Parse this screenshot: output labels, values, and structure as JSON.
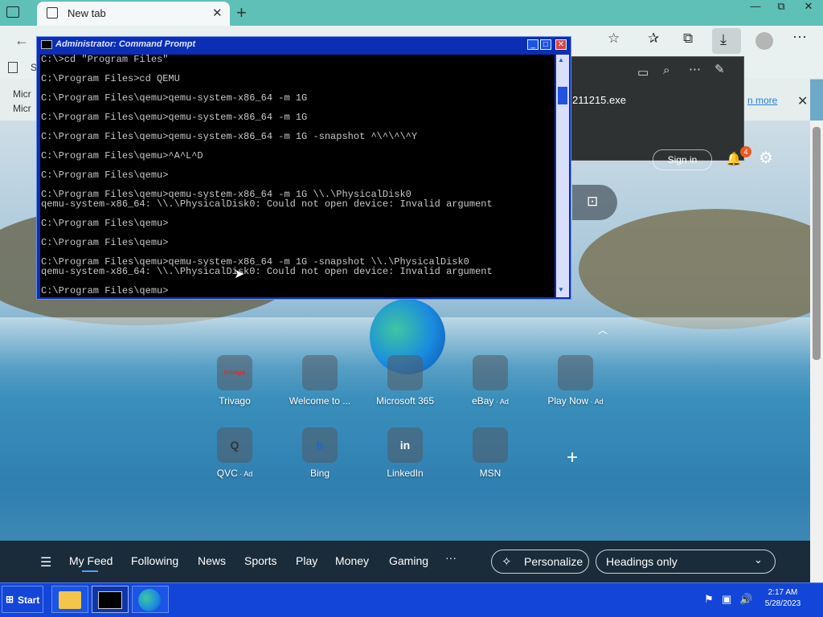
{
  "browser": {
    "tab_title": "New tab",
    "tab_close": "✕",
    "new_tab_icon": "+",
    "window_controls": [
      "—",
      "⧉",
      "✕"
    ],
    "fav_first_letter": "S",
    "message_lines": [
      "Micr",
      "Micr"
    ],
    "download_filename": "211215.exe",
    "download_link_partial": "n more",
    "signin_label": "Sign in",
    "notif_count": "4"
  },
  "cmd": {
    "title": "Administrator: Command Prompt",
    "lines": [
      "C:\\>cd \"Program Files\"",
      "",
      "C:\\Program Files>cd QEMU",
      "",
      "C:\\Program Files\\qemu>qemu-system-x86_64 -m 1G",
      "",
      "C:\\Program Files\\qemu>qemu-system-x86_64 -m 1G",
      "",
      "C:\\Program Files\\qemu>qemu-system-x86_64 -m 1G -snapshot ^\\^\\^\\^Y",
      "",
      "C:\\Program Files\\qemu>^A^L^D",
      "",
      "C:\\Program Files\\qemu>",
      "",
      "C:\\Program Files\\qemu>qemu-system-x86_64 -m 1G \\\\.\\PhysicalDisk0",
      "qemu-system-x86_64: \\\\.\\PhysicalDisk0: Could not open device: Invalid argument",
      "",
      "C:\\Program Files\\qemu>",
      "",
      "C:\\Program Files\\qemu>",
      "",
      "C:\\Program Files\\qemu>qemu-system-x86_64 -m 1G -snapshot \\\\.\\PhysicalDisk0",
      "qemu-system-x86_64: \\\\.\\PhysicalDisk0: Could not open device: Invalid argument",
      "",
      "C:\\Program Files\\qemu>"
    ]
  },
  "quick_links": [
    {
      "label": "Trivago",
      "ad": "",
      "glyph": "trivago",
      "color": "#ffffff"
    },
    {
      "label": "Welcome to ...",
      "ad": "",
      "glyph": "",
      "color": "#1e7ad8"
    },
    {
      "label": "Microsoft 365",
      "ad": "",
      "glyph": "",
      "color": "#6a4fd0"
    },
    {
      "label": "eBay",
      "ad": " · Ad",
      "glyph": "",
      "color": "#111111"
    },
    {
      "label": "Play Now",
      "ad": " · Ad",
      "glyph": "",
      "color": "#7a2a1a"
    },
    {
      "label": "QVC",
      "ad": " · Ad",
      "glyph": "Q",
      "color": "#ffffff"
    },
    {
      "label": "Bing",
      "ad": "",
      "glyph": "b",
      "color": "#ffffff"
    },
    {
      "label": "LinkedIn",
      "ad": "",
      "glyph": "in",
      "color": "#0a66c2"
    },
    {
      "label": "MSN",
      "ad": "",
      "glyph": "",
      "color": "#ffffff"
    }
  ],
  "feed_nav": {
    "items": [
      "My Feed",
      "Following",
      "News",
      "Sports",
      "Play",
      "Money",
      "Gaming",
      "···"
    ],
    "personalize": "Personalize",
    "headings_select": "Headings only"
  },
  "taskbar": {
    "start_label": "Start",
    "time": "2:17 AM",
    "date": "5/28/2023"
  },
  "colors": {
    "tabstrip": "#5fc0b8",
    "cmd_frame": "#0b2eb5",
    "taskbar": "#1346d8"
  }
}
